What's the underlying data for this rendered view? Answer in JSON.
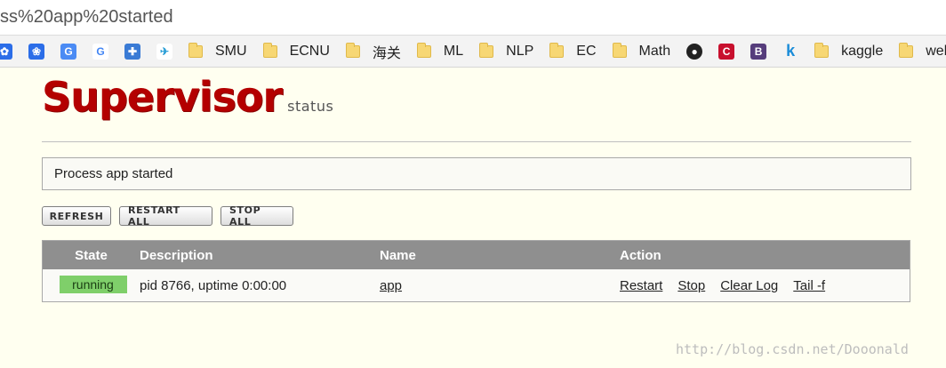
{
  "browser": {
    "url_fragment": "ss%20app%20started",
    "bookmarks": [
      {
        "icon": "baidu-icon",
        "color": "#2b6de8"
      },
      {
        "icon": "baidu-paw-icon",
        "color": "#2b6de8"
      },
      {
        "icon": "translate-icon",
        "color": "#4b8bf4"
      },
      {
        "icon": "google-icon",
        "color": "#4285f4"
      },
      {
        "icon": "puzzle-icon",
        "color": "#3a7bd5"
      },
      {
        "icon": "plane-icon",
        "color": "#2a9ed6"
      },
      {
        "folder": "SMU"
      },
      {
        "folder": "ECNU"
      },
      {
        "folder": "海关"
      },
      {
        "folder": "ML"
      },
      {
        "folder": "NLP"
      },
      {
        "folder": "EC"
      },
      {
        "folder": "Math"
      },
      {
        "icon": "github-icon",
        "color": "#222222"
      },
      {
        "icon": "csdn-icon",
        "color": "#c8102e"
      },
      {
        "icon": "bootstrap-icon",
        "color": "#563d7c"
      },
      {
        "icon": "k-icon",
        "color": "#1a8cd8"
      },
      {
        "folder": "kaggle"
      },
      {
        "folder": "web"
      }
    ]
  },
  "logo": {
    "main": "Supervisor",
    "sub": "status"
  },
  "message": "Process app started",
  "buttons": {
    "refresh": "REFRESH",
    "restart_all": "RESTART ALL",
    "stop_all": "STOP ALL"
  },
  "table": {
    "headers": {
      "state": "State",
      "description": "Description",
      "name": "Name",
      "action": "Action"
    },
    "rows": [
      {
        "state": "running",
        "description": "pid 8766, uptime 0:00:00",
        "name": "app",
        "actions": [
          "Restart",
          "Stop",
          "Clear Log",
          "Tail -f"
        ]
      }
    ]
  },
  "watermark": "http://blog.csdn.net/Dooonald",
  "colors": {
    "running": "#7fcf6a",
    "logo": "#b40000",
    "header": "#8f8f8f"
  }
}
